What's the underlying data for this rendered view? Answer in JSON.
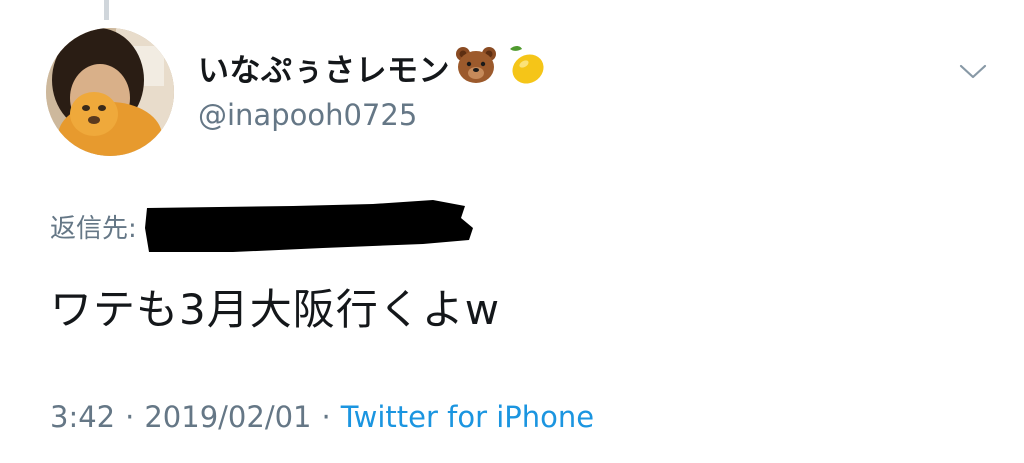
{
  "tweet": {
    "display_name": "いなぷぅさレモン",
    "name_emojis": [
      "bear-emoji-icon",
      "lemon-emoji-icon"
    ],
    "handle": "@inapooh0725",
    "reply_label": "返信先:",
    "text": "ワテも3月大阪行くよw",
    "time": "3:42",
    "separator": "·",
    "date": "2019/02/01",
    "source": "Twitter for iPhone"
  },
  "colors": {
    "primary_text": "#14171a",
    "secondary_text": "#657786",
    "link": "#1b95e0",
    "thread_line": "#d0d6db"
  },
  "icons": {
    "more_menu": "chevron-down-icon",
    "avatar": "avatar"
  }
}
